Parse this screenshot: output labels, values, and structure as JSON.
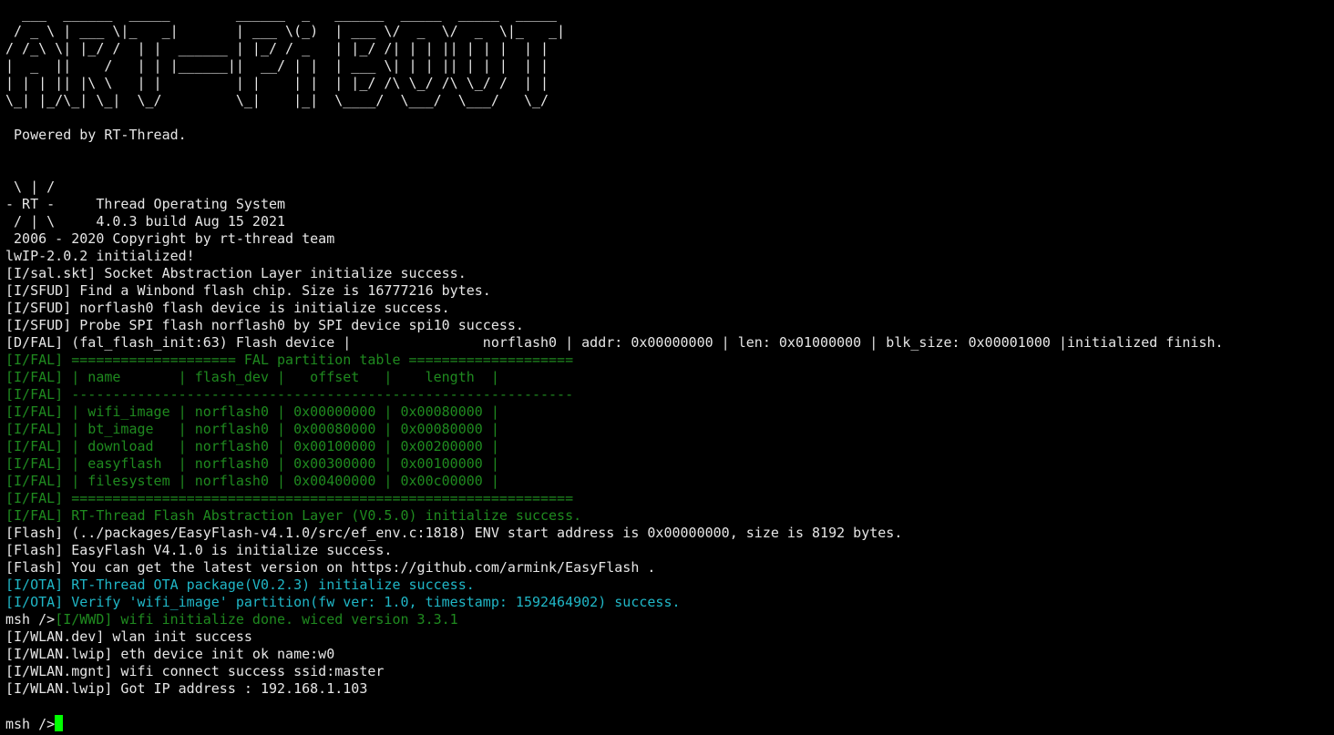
{
  "colors": {
    "background": "#000000",
    "default_text": "#e6e6e6",
    "fal_green": "#1f8a1f",
    "ota_cyan": "#20b7c7",
    "cursor": "#00ff00"
  },
  "banner": [
    "  ___  ______  _____        ______  _   ______  _____  _____  _____",
    " / _ \\ | ___ \\|_   _|       | ___ \\(_)  | ___ \\/  _  \\/  _  \\|_   _|",
    "/ /_\\ \\| |_/ /  | |  ______ | |_/ / _   | |_/ /| | | || | | |  | |",
    "|  _  ||    /   | | |______||  __/ | |  | ___ \\| | | || | | |  | |",
    "| | | || |\\ \\   | |         | |    | |  | |_/ /\\ \\_/ /\\ \\_/ /  | |",
    "\\_| |_/\\_| \\_|  \\_/         \\_|    |_|  \\____/  \\___/  \\___/   \\_/"
  ],
  "powered_by": " Powered by RT-Thread.",
  "rt_logo": [
    " \\ | /",
    "- RT -     Thread Operating System",
    " / | \\     4.0.3 build Aug 15 2021",
    " 2006 - 2020 Copyright by rt-thread team"
  ],
  "log_lines": [
    {
      "text": "lwIP-2.0.2 initialized!",
      "color": "white"
    },
    {
      "text": "[I/sal.skt] Socket Abstraction Layer initialize success.",
      "color": "white"
    },
    {
      "text": "[I/SFUD] Find a Winbond flash chip. Size is 16777216 bytes.",
      "color": "white"
    },
    {
      "text": "[I/SFUD] norflash0 flash device is initialize success.",
      "color": "white"
    },
    {
      "text": "[I/SFUD] Probe SPI flash norflash0 by SPI device spi10 success.",
      "color": "white"
    },
    {
      "text": "[D/FAL] (fal_flash_init:63) Flash device |                norflash0 | addr: 0x00000000 | len: 0x01000000 | blk_size: 0x00001000 |initialized finish.",
      "color": "white"
    },
    {
      "text": "[I/FAL] ==================== FAL partition table ====================",
      "color": "green"
    },
    {
      "text": "[I/FAL] | name       | flash_dev |   offset   |    length  |",
      "color": "green"
    },
    {
      "text": "[I/FAL] -------------------------------------------------------------",
      "color": "green"
    },
    {
      "text": "[I/FAL] | wifi_image | norflash0 | 0x00000000 | 0x00080000 |",
      "color": "green"
    },
    {
      "text": "[I/FAL] | bt_image   | norflash0 | 0x00080000 | 0x00080000 |",
      "color": "green"
    },
    {
      "text": "[I/FAL] | download   | norflash0 | 0x00100000 | 0x00200000 |",
      "color": "green"
    },
    {
      "text": "[I/FAL] | easyflash  | norflash0 | 0x00300000 | 0x00100000 |",
      "color": "green"
    },
    {
      "text": "[I/FAL] | filesystem | norflash0 | 0x00400000 | 0x00c00000 |",
      "color": "green"
    },
    {
      "text": "[I/FAL] =============================================================",
      "color": "green"
    },
    {
      "text": "[I/FAL] RT-Thread Flash Abstraction Layer (V0.5.0) initialize success.",
      "color": "green"
    },
    {
      "text": "[Flash] (../packages/EasyFlash-v4.1.0/src/ef_env.c:1818) ENV start address is 0x00000000, size is 8192 bytes.",
      "color": "white"
    },
    {
      "text": "[Flash] EasyFlash V4.1.0 is initialize success.",
      "color": "white"
    },
    {
      "text": "[Flash] You can get the latest version on https://github.com/armink/EasyFlash .",
      "color": "white"
    },
    {
      "text": "[I/OTA] RT-Thread OTA package(V0.2.3) initialize success.",
      "color": "cyan"
    },
    {
      "text": "[I/OTA] Verify 'wifi_image' partition(fw ver: 1.0, timestamp: 1592464902) success.",
      "color": "cyan"
    }
  ],
  "wwd_line": {
    "prompt": "msh />",
    "message": "[I/WWD] wifi initialize done. wiced version 3.3.1"
  },
  "wlan_lines": [
    "[I/WLAN.dev] wlan init success",
    "[I/WLAN.lwip] eth device init ok name:w0",
    "[I/WLAN.mgnt] wifi connect success ssid:master",
    "[I/WLAN.lwip] Got IP address : 192.168.1.103"
  ],
  "final_prompt": "msh />"
}
